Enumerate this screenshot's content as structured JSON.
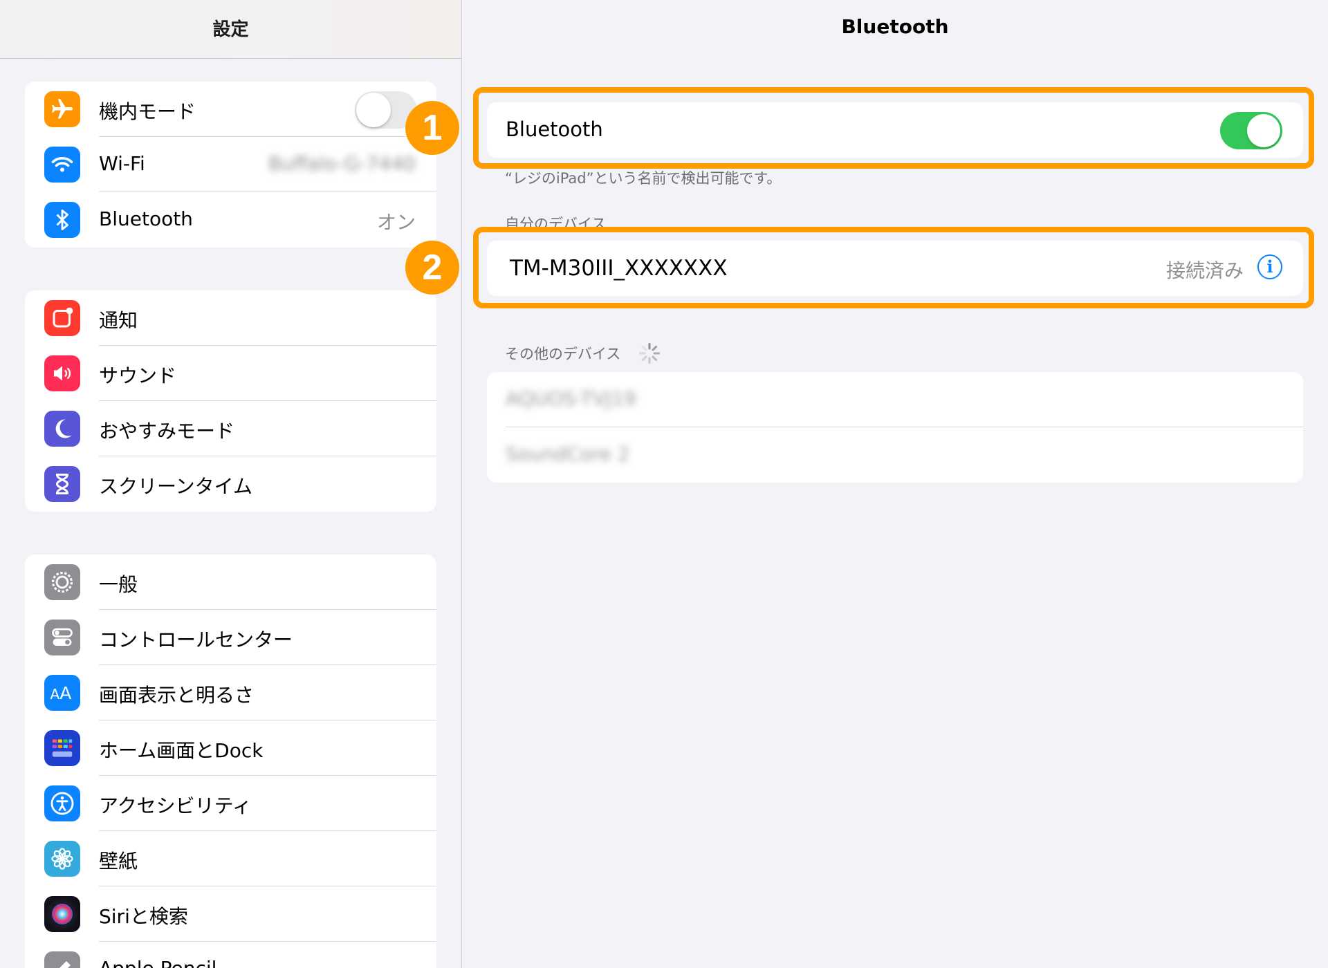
{
  "sidebar": {
    "title": "設定",
    "groups": [
      {
        "items": [
          {
            "label": "機内モード",
            "icon": "airplane-icon",
            "color": "#ff9500",
            "toggle": false
          },
          {
            "label": "Wi-Fi",
            "icon": "wifi-icon",
            "color": "#0a84ff",
            "value": "Buffalo-G-7440"
          },
          {
            "label": "Bluetooth",
            "icon": "bluetooth-icon",
            "color": "#0a84ff",
            "value": "オン"
          }
        ]
      },
      {
        "items": [
          {
            "label": "通知",
            "icon": "notifications-icon",
            "color": "#ff3b30"
          },
          {
            "label": "サウンド",
            "icon": "speaker-icon",
            "color": "#ff2d55"
          },
          {
            "label": "おやすみモード",
            "icon": "moon-icon",
            "color": "#5856d6"
          },
          {
            "label": "スクリーンタイム",
            "icon": "hourglass-icon",
            "color": "#5856d6"
          }
        ]
      },
      {
        "items": [
          {
            "label": "一般",
            "icon": "gear-icon",
            "color": "#8e8e93"
          },
          {
            "label": "コントロールセンター",
            "icon": "switches-icon",
            "color": "#8e8e93"
          },
          {
            "label": "画面表示と明るさ",
            "icon": "text-size-icon",
            "color": "#0a84ff"
          },
          {
            "label": "ホーム画面とDock",
            "icon": "home-grid-icon",
            "color": "#1f3fcf"
          },
          {
            "label": "アクセシビリティ",
            "icon": "accessibility-icon",
            "color": "#0a84ff"
          },
          {
            "label": "壁紙",
            "icon": "flower-icon",
            "color": "#34aadc"
          },
          {
            "label": "Siriと検索",
            "icon": "siri-icon",
            "color": "#1c1c1e"
          },
          {
            "label": "Apple Pencil",
            "icon": "pencil-icon",
            "color": "#8e8e93"
          }
        ]
      }
    ]
  },
  "detail": {
    "title": "Bluetooth",
    "bluetooth_row": {
      "label": "Bluetooth",
      "enabled": true
    },
    "discoverable_note": "“レジのiPad”という名前で検出可能です。",
    "my_devices_header": "自分のデバイス",
    "my_devices": [
      {
        "name": "TM-M30III_XXXXXXX",
        "status": "接続済み",
        "icon": "info-icon"
      }
    ],
    "other_devices_header": "その他のデバイス",
    "other_devices": [
      {
        "name": "AQUOS-TVJ19"
      },
      {
        "name": "SoundCore 2"
      }
    ]
  },
  "annotations": [
    {
      "number": "1",
      "color": "#ff9d00"
    },
    {
      "number": "2",
      "color": "#ff9d00"
    }
  ]
}
